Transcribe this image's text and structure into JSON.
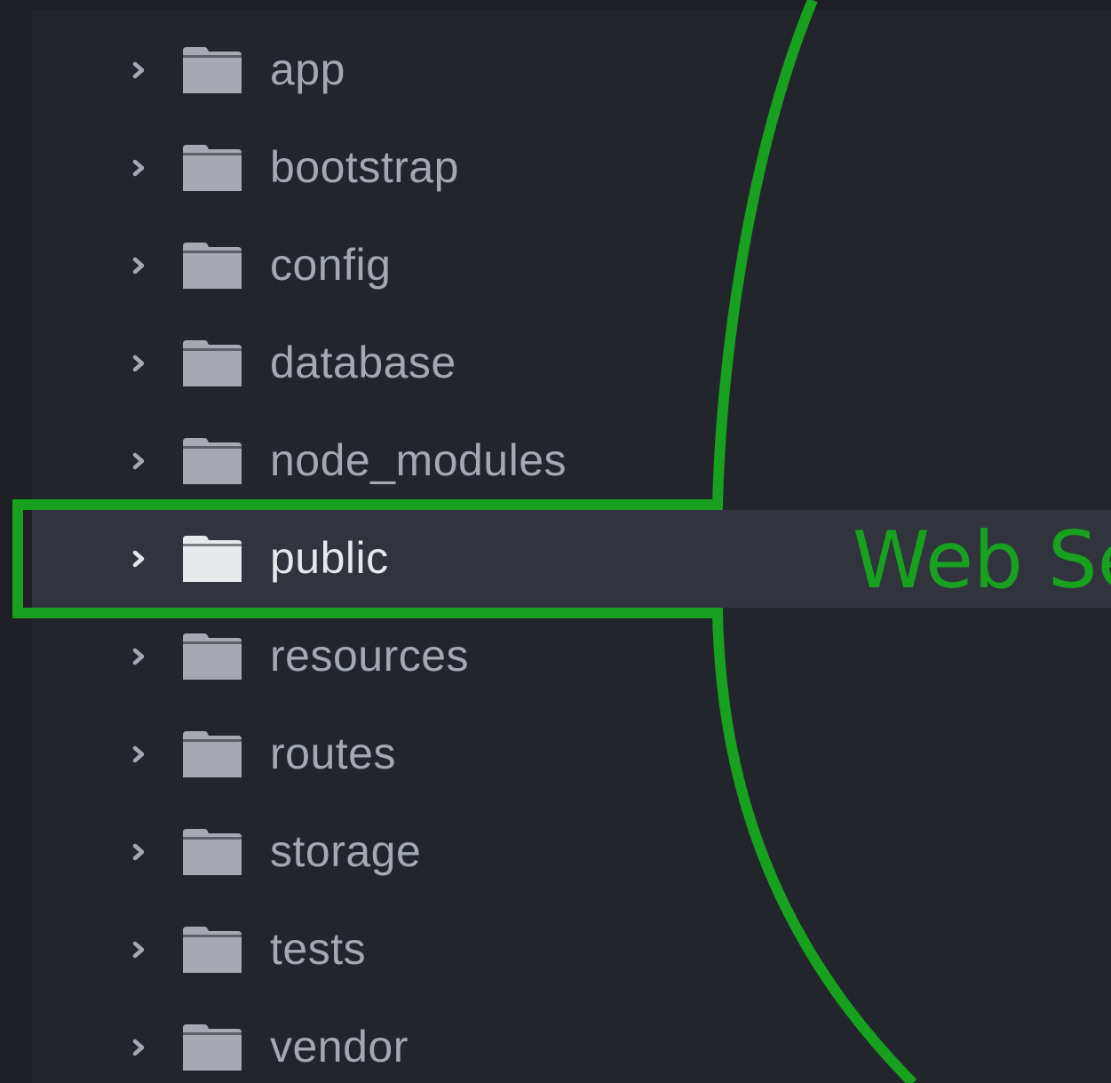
{
  "file_tree": {
    "items": [
      {
        "name": "app",
        "icon": "folder-icon"
      },
      {
        "name": "bootstrap",
        "icon": "folder-icon"
      },
      {
        "name": "config",
        "icon": "folder-icon"
      },
      {
        "name": "database",
        "icon": "folder-icon"
      },
      {
        "name": "node_modules",
        "icon": "folder-icon"
      },
      {
        "name": "public",
        "icon": "folder-icon",
        "selected": true
      },
      {
        "name": "resources",
        "icon": "folder-icon"
      },
      {
        "name": "routes",
        "icon": "folder-icon"
      },
      {
        "name": "storage",
        "icon": "folder-icon"
      },
      {
        "name": "tests",
        "icon": "folder-icon"
      },
      {
        "name": "vendor",
        "icon": "folder-icon"
      }
    ]
  },
  "annotation": {
    "label": "Web Se",
    "color": "#17a11e"
  },
  "colors": {
    "background": "#22252b",
    "selected_row": "#31343d",
    "text": "#a4a8b2",
    "text_selected": "#e6e8ec",
    "folder": "#a6a9b1",
    "folder_selected": "#e8e9ec",
    "highlight": "#17a11e"
  }
}
